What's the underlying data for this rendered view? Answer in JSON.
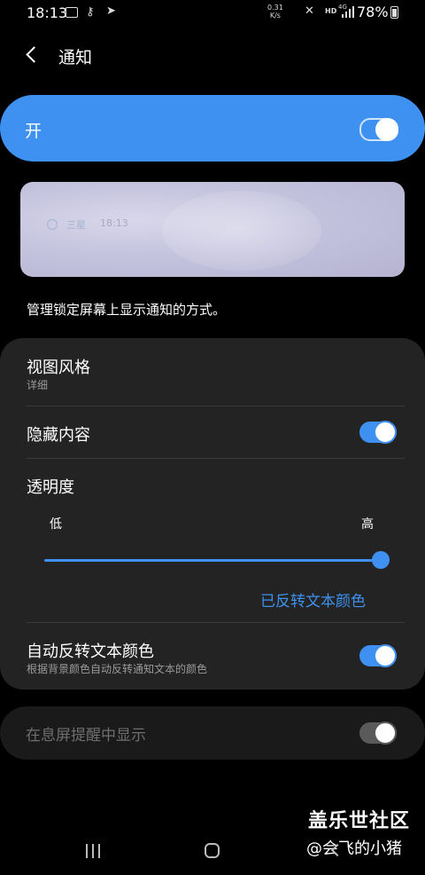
{
  "status_bar": {
    "time": "18:13",
    "speed_value": "0.31",
    "speed_unit": "K/s",
    "hd": "HD",
    "network": "4G",
    "battery": "78%"
  },
  "header": {
    "title": "通知"
  },
  "master_switch": {
    "label": "开",
    "state": "on"
  },
  "preview": {
    "app_name": "三星",
    "time": "18:13"
  },
  "description": "管理锁定屏幕上显示通知的方式。",
  "settings": {
    "view_style": {
      "title": "视图风格",
      "value": "详细"
    },
    "hide_content": {
      "title": "隐藏内容",
      "state": "on"
    },
    "transparency": {
      "title": "透明度",
      "low_label": "低",
      "high_label": "高",
      "level": 1.0
    },
    "inverted_colors_link": "已反转文本颜色",
    "auto_reverse": {
      "title": "自动反转文本颜色",
      "subtitle": "根据背景颜色自动反转通知文本的颜色",
      "state": "on"
    }
  },
  "aod": {
    "title": "在息屏提醒中显示",
    "state": "on-disabled"
  },
  "watermark": {
    "site": "盖乐世社区",
    "user": "@会飞的小猪"
  },
  "colors": {
    "accent": "#3e91f0",
    "panel": "#232323",
    "background": "#000000"
  }
}
